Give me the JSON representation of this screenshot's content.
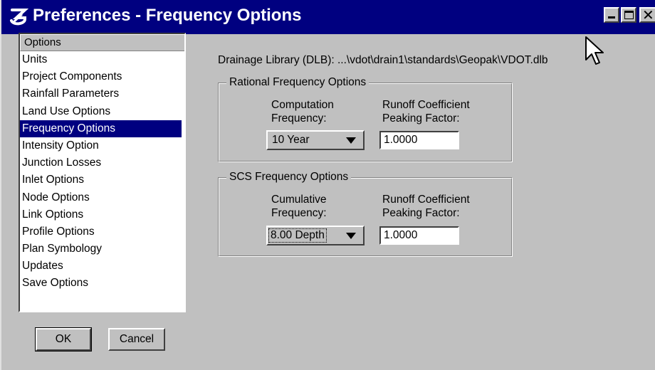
{
  "window": {
    "title": "Preferences - Frequency Options",
    "app_icon": "geopak-logo-icon",
    "controls": [
      "minimize-icon",
      "maximize-icon",
      "close-icon"
    ]
  },
  "options_list": {
    "header": "Options",
    "items": [
      "Units",
      "Project Components",
      "Rainfall Parameters",
      "Land Use Options",
      "Frequency Options",
      "Intensity Option",
      "Junction Losses",
      "Inlet Options",
      "Node Options",
      "Link Options",
      "Profile Options",
      "Plan Symbology",
      "Updates",
      "Save Options"
    ],
    "selected": "Frequency Options"
  },
  "buttons": {
    "ok": "OK",
    "cancel": "Cancel"
  },
  "dlb_line": "Drainage Library (DLB): ...\\vdot\\drain1\\standards\\Geopak\\VDOT.dlb",
  "rational": {
    "title": "Rational Frequency Options",
    "freq_label_1": "Computation",
    "freq_label_2": "Frequency:",
    "coef_label_1": "Runoff Coefficient",
    "coef_label_2": "Peaking Factor:",
    "frequency": "10 Year",
    "coefficient": "1.0000"
  },
  "scs": {
    "title": "SCS Frequency Options",
    "freq_label_1": "Cumulative",
    "freq_label_2": "Frequency:",
    "coef_label_1": "Runoff Coefficient",
    "coef_label_2": "Peaking Factor:",
    "frequency": "8.00 Depth",
    "coefficient": "1.0000"
  },
  "colors": {
    "title_bar": "#000080",
    "face": "#c0c0c0",
    "selection": "#000080"
  }
}
